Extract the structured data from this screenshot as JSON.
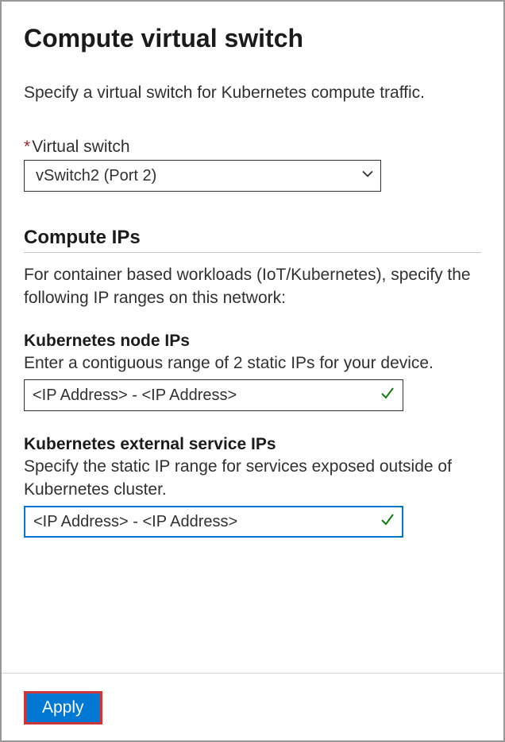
{
  "title": "Compute virtual switch",
  "description": "Specify a virtual switch for Kubernetes compute traffic.",
  "virtualSwitch": {
    "label": "Virtual switch",
    "selected": "vSwitch2 (Port 2)"
  },
  "computeIPs": {
    "heading": "Compute IPs",
    "description": "For container based workloads (IoT/Kubernetes), specify the following IP ranges on this network:"
  },
  "nodeIPs": {
    "label": "Kubernetes node IPs",
    "description": "Enter a contiguous range of 2 static IPs for your device.",
    "value": "<IP Address> - <IP Address>"
  },
  "serviceIPs": {
    "label": "Kubernetes external service IPs",
    "description": "Specify the static IP range for services exposed outside of Kubernetes cluster.",
    "value": "<IP Address> - <IP Address>"
  },
  "footer": {
    "applyLabel": "Apply"
  }
}
